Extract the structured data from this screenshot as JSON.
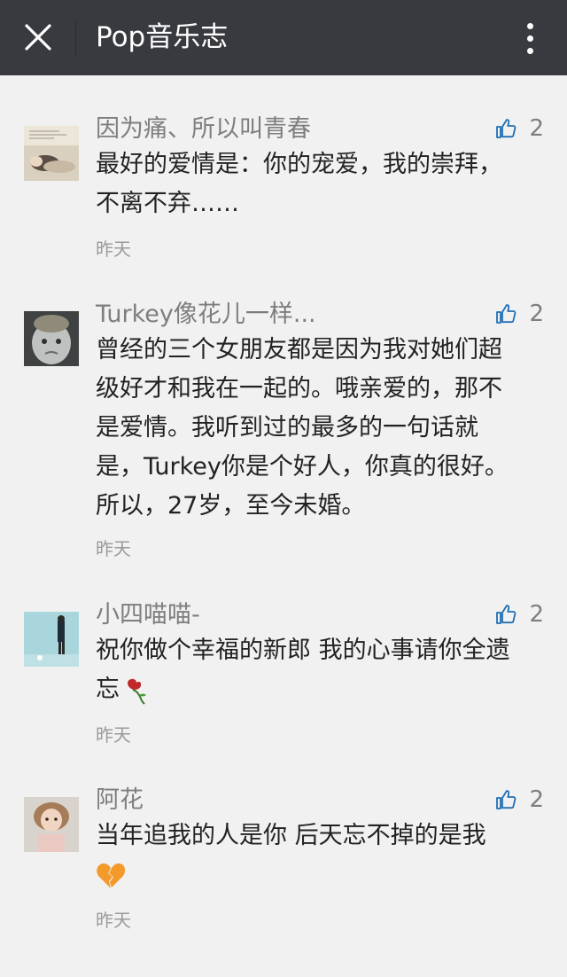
{
  "header": {
    "title": "Pop音乐志",
    "close_icon": "close-icon",
    "more_icon": "more-vertical-icon"
  },
  "comments": [
    {
      "nickname": "因为痛、所以叫青春",
      "likes": "2",
      "lines": [
        "最好的爱情是：你的宠爱，我的崇拜，",
        "不离不弃……"
      ],
      "time": "昨天"
    },
    {
      "nickname": "Turkey像花儿一样...",
      "likes": "2",
      "lines": [
        "曾经的三个女朋友都是因为我对她们超",
        "级好才和我在一起的。哦亲爱的，那不",
        "是爱情。我听到过的最多的一句话就",
        "是，Turkey你是个好人，你真的很好。",
        "所以，27岁，至今未婚。"
      ],
      "time": "昨天"
    },
    {
      "nickname": "小四喵喵-",
      "likes": "2",
      "lines": [
        "祝你做个幸福的新郎 我的心事请你全遗",
        "忘"
      ],
      "emoji": "wilted-rose-emoji",
      "time": "昨天"
    },
    {
      "nickname": "阿花",
      "likes": "2",
      "lines": [
        "当年追我的人是你  后天忘不掉的是我"
      ],
      "emoji": "broken-heart-emoji",
      "time": "昨天"
    }
  ],
  "colors": {
    "topbar": "#393a3f",
    "background": "#f1f1f1",
    "like_icon": "#1f6fb5",
    "nickname": "#7e7e7e",
    "content": "#222222",
    "time": "#9a9a9a"
  }
}
